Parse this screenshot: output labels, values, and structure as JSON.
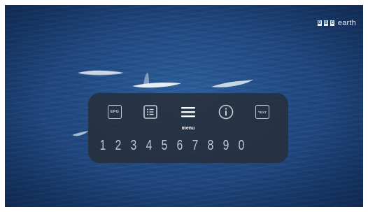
{
  "brand": {
    "logo_letters": [
      "B",
      "B",
      "C"
    ],
    "wordmark": "earth"
  },
  "overlay": {
    "buttons": [
      {
        "label": "EPG",
        "icon": "epg-icon"
      },
      {
        "label": "",
        "icon": "list-icon"
      },
      {
        "label": "",
        "icon": "menu-icon"
      },
      {
        "label": "",
        "icon": "info-icon"
      },
      {
        "label": "TEXT",
        "icon": "text-icon"
      }
    ],
    "menu_label": "menu",
    "digits": [
      "1",
      "2",
      "3",
      "4",
      "5",
      "6",
      "7",
      "8",
      "9",
      "0"
    ]
  },
  "colors": {
    "ocean": "#214a82",
    "overlay_bg": "#262e3a",
    "icon": "#c9ced6",
    "text_white": "#ffffff"
  }
}
